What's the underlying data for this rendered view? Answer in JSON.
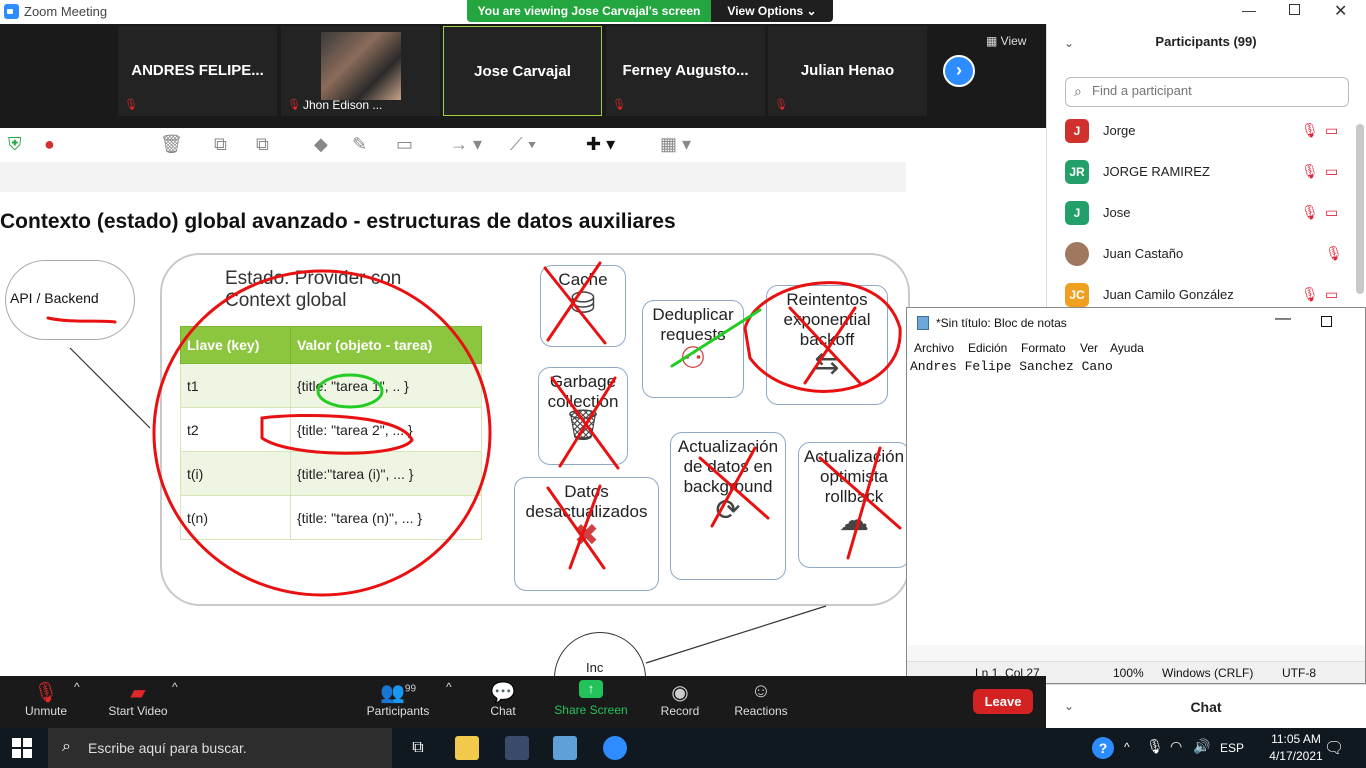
{
  "window": {
    "title": "Zoom Meeting"
  },
  "banner": {
    "viewing": "You are viewing Jose Carvajal's screen",
    "view_options": "View Options ⌄"
  },
  "strip": {
    "tiles": [
      {
        "name": "ANDRES  FELIPE..."
      },
      {
        "name": "Jhon Edison ..."
      },
      {
        "name": "Jose Carvajal"
      },
      {
        "name": "Ferney  Augusto..."
      },
      {
        "name": "Julian Henao"
      }
    ],
    "view_label": "View"
  },
  "slide": {
    "title": "Contexto (estado) global avanzado - estructuras de datos auxiliares",
    "cloud": "API / Backend",
    "provider_title": "Estado: Provider con Context global",
    "table": {
      "headers": [
        "Llave (key)",
        "Valor (objeto -  tarea)"
      ],
      "rows": [
        [
          "t1",
          "{title: \"tarea 1\", .. }"
        ],
        [
          "t2",
          "{title: \"tarea 2\", ... }"
        ],
        [
          "t(i)",
          "{title:\"tarea (i)\", ... }"
        ],
        [
          "t(n)",
          "{title: \"tarea (n)\", ... }"
        ]
      ]
    },
    "cards": {
      "cache": "Cache",
      "dedup": "Deduplicar requests",
      "retry": "Reintentos exponential backoff",
      "gc": "Garbage collection",
      "bg": "Actualización de datos en background",
      "optimistic": "Actualización optimista rollback",
      "stale": "Datos desactualizados",
      "circle": "Inc"
    }
  },
  "participants": {
    "header": "Participants (99)",
    "search_placeholder": "Find a participant",
    "list": [
      {
        "initials": "J",
        "name": "Jorge",
        "color": "#d0312d"
      },
      {
        "initials": "JR",
        "name": "JORGE RAMIREZ",
        "color": "#23a06a"
      },
      {
        "initials": "J",
        "name": "Jose",
        "color": "#23a06a"
      },
      {
        "initials": "",
        "name": "Juan  Castaño",
        "color": "#a07860"
      },
      {
        "initials": "JC",
        "name": "Juan Camilo González",
        "color": "#f0a020"
      }
    ]
  },
  "notepad": {
    "title": "*Sin título: Bloc de notas",
    "menu": [
      "Archivo",
      "Edición",
      "Formato",
      "Ver",
      "Ayuda"
    ],
    "text": "Andres Felipe Sanchez Cano",
    "status": {
      "position": "Ln 1, Col 27",
      "zoom": "100%",
      "eol": "Windows (CRLF)",
      "encoding": "UTF-8"
    }
  },
  "chat": {
    "label": "Chat"
  },
  "controls": {
    "unmute": "Unmute",
    "start_video": "Start Video",
    "participants": "Participants",
    "participants_count": "99",
    "chat": "Chat",
    "share_screen": "Share Screen",
    "record": "Record",
    "reactions": "Reactions",
    "leave": "Leave"
  },
  "taskbar": {
    "search_placeholder": "Escribe aquí para buscar.",
    "language": "ESP",
    "time": "11:05 AM",
    "date": "4/17/2021"
  }
}
